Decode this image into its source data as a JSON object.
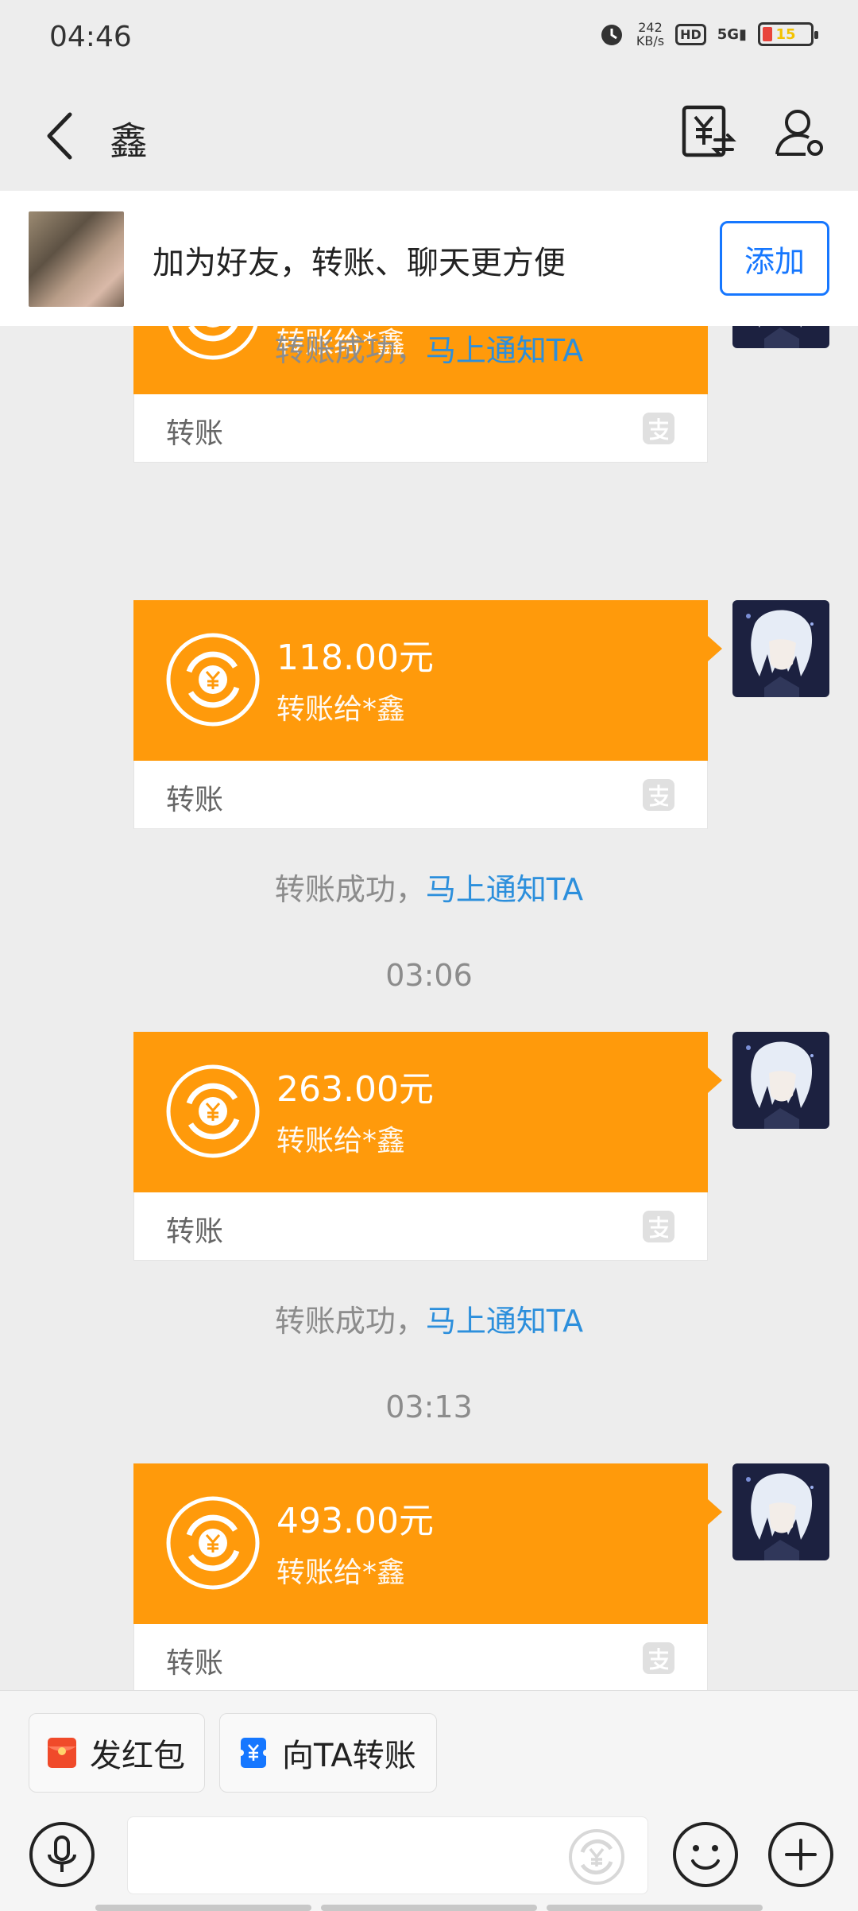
{
  "status": {
    "time": "04:46",
    "net_speed_value": "242",
    "net_speed_unit": "KB/s",
    "hd": "HD",
    "network": "5G",
    "battery_level": "15"
  },
  "nav": {
    "title": "鑫"
  },
  "banner": {
    "text": "加为好友，转账、聊天更方便",
    "add_label": "添加"
  },
  "messages": [
    {
      "amount": "",
      "subtitle": "转账给*鑫",
      "label": "转账"
    },
    {
      "amount": "118.00元",
      "subtitle": "转账给*鑫",
      "label": "转账"
    },
    {
      "amount": "263.00元",
      "subtitle": "转账给*鑫",
      "label": "转账"
    },
    {
      "amount": "493.00元",
      "subtitle": "转账给*鑫",
      "label": "转账"
    }
  ],
  "system_notices": [
    {
      "text": "转账成功，",
      "link": "马上通知TA"
    },
    {
      "text": "转账成功，",
      "link": "马上通知TA"
    },
    {
      "text": "转账成功，",
      "link": "马上通知TA"
    }
  ],
  "timestamps": [
    "03:06",
    "03:13"
  ],
  "bottom": {
    "red_packet_label": "发红包",
    "transfer_label": "向TA转账"
  },
  "colors": {
    "accent_orange": "#ff9a0b",
    "link_blue": "#2c8fdc",
    "button_blue": "#1677ff"
  }
}
